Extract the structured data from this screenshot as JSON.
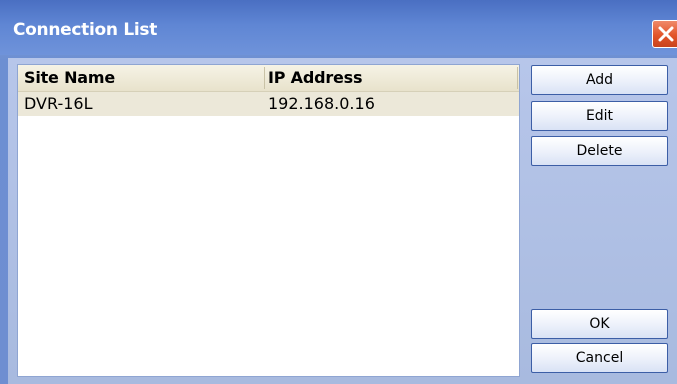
{
  "window": {
    "title": "Connection List",
    "accent_color": "#5f86d4",
    "close_icon": "close-icon"
  },
  "list": {
    "columns": [
      "Site Name",
      "IP Address"
    ],
    "rows": [
      {
        "site_name": "DVR-16L",
        "ip_address": "192.168.0.16",
        "selected": true
      }
    ]
  },
  "buttons": {
    "add": "Add",
    "edit": "Edit",
    "delete": "Delete",
    "ok": "OK",
    "cancel": "Cancel"
  }
}
